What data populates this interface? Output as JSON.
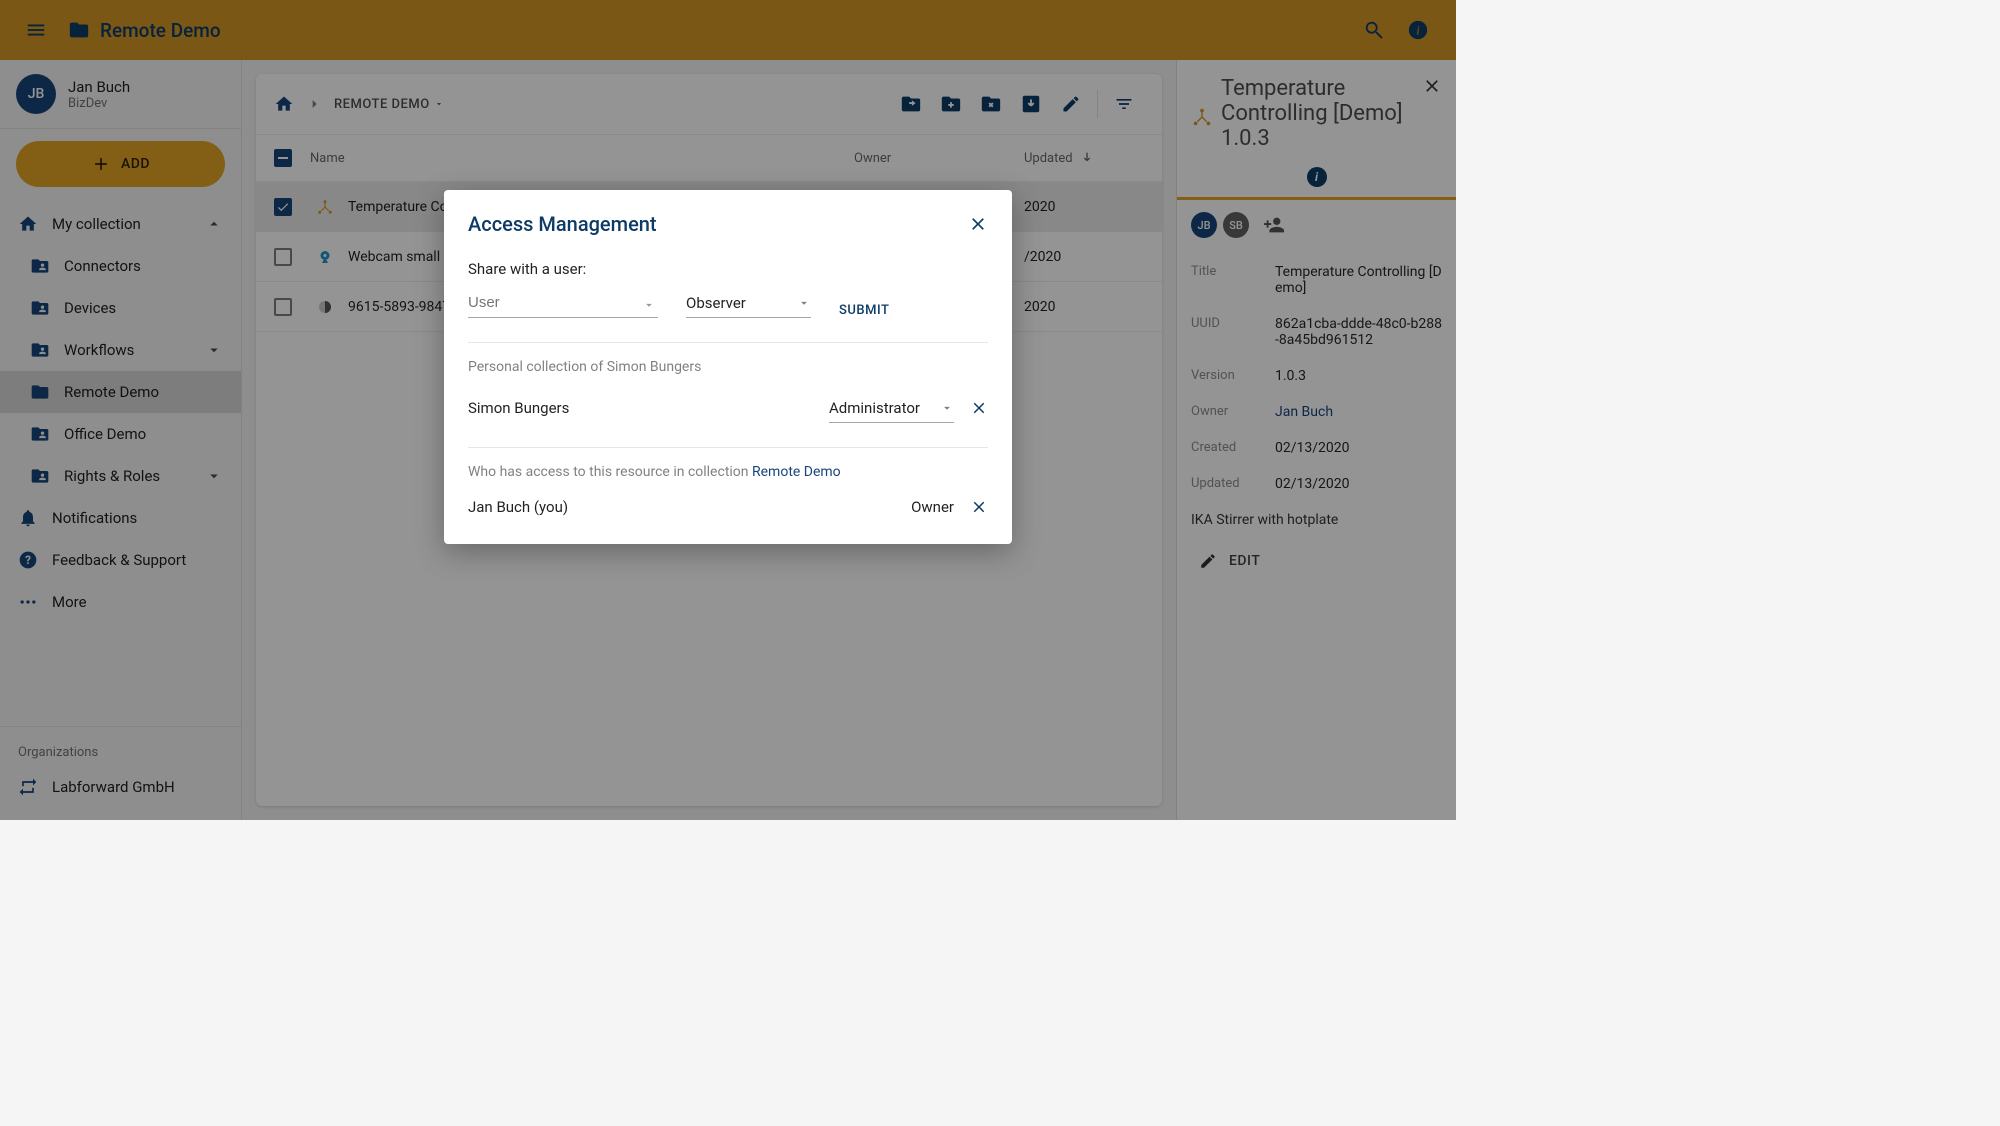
{
  "colors": {
    "primary": "#0d3b66",
    "accent": "#e0a423"
  },
  "topbar": {
    "title": "Remote Demo"
  },
  "user": {
    "initials": "JB",
    "name": "Jan Buch",
    "role": "BizDev"
  },
  "sidebar": {
    "addLabel": "ADD",
    "myCollection": "My collection",
    "items": [
      {
        "label": "Connectors"
      },
      {
        "label": "Devices"
      },
      {
        "label": "Workflows",
        "expandable": true
      },
      {
        "label": "Remote Demo",
        "selected": true
      },
      {
        "label": "Office Demo"
      },
      {
        "label": "Rights & Roles",
        "expandable": true
      }
    ],
    "notifications": "Notifications",
    "feedback": "Feedback & Support",
    "more": "More",
    "orgLabel": "Organizations",
    "orgs": [
      {
        "label": "Labforward GmbH"
      }
    ]
  },
  "breadcrumb": {
    "current": "REMOTE DEMO"
  },
  "table": {
    "headers": {
      "name": "Name",
      "owner": "Owner",
      "updated": "Updated"
    },
    "rows": [
      {
        "checked": true,
        "name": "Temperature Co...",
        "date": "2020"
      },
      {
        "checked": false,
        "name": "Webcam small",
        "date": "/2020"
      },
      {
        "checked": false,
        "name": "9615-5893-9847",
        "date": "2020"
      }
    ]
  },
  "modal": {
    "title": "Access Management",
    "shareLabel": "Share with a user:",
    "userPlaceholder": "User",
    "roleDefault": "Observer",
    "submitLabel": "SUBMIT",
    "personalCollectionLabel": "Personal collection of Simon Bungers",
    "sharedUsers": [
      {
        "name": "Simon Bungers",
        "role": "Administrator"
      }
    ],
    "accessQuestionPrefix": "Who has access to this resource in collection ",
    "accessCollectionLink": "Remote Demo",
    "owners": [
      {
        "name": "Jan Buch (you)",
        "role": "Owner"
      }
    ]
  },
  "rightpanel": {
    "title": "Temperature Controlling [Demo] 1.0.3",
    "shared": [
      {
        "initials": "JB"
      },
      {
        "initials": "SB"
      }
    ],
    "meta": {
      "titleKey": "Title",
      "titleVal": "Temperature Controlling [Demo]",
      "uuidKey": "UUID",
      "uuidVal": "862a1cba-ddde-48c0-b288-8a45bd961512",
      "versionKey": "Version",
      "versionVal": "1.0.3",
      "ownerKey": "Owner",
      "ownerVal": "Jan Buch",
      "createdKey": "Created",
      "createdVal": "02/13/2020",
      "updatedKey": "Updated",
      "updatedVal": "02/13/2020"
    },
    "description": "IKA Stirrer with hotplate",
    "editLabel": "EDIT"
  }
}
